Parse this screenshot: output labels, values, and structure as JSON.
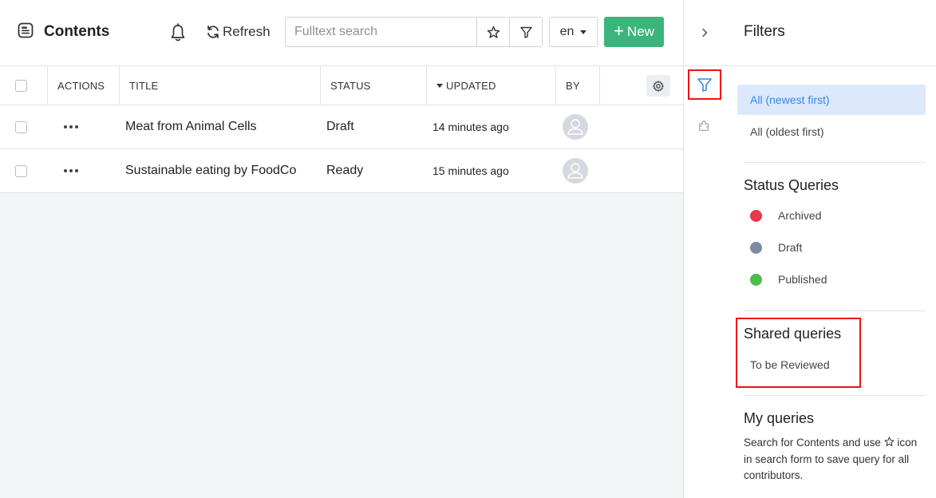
{
  "header": {
    "title": "Contents",
    "refresh_label": "Refresh",
    "search_placeholder": "Fulltext search",
    "language": "en",
    "new_label": "New"
  },
  "table": {
    "columns": [
      "ACTIONS",
      "TITLE",
      "STATUS",
      "UPDATED",
      "BY"
    ],
    "rows": [
      {
        "title": "Meat from Animal Cells",
        "status": "Draft",
        "updated": "14 minutes ago"
      },
      {
        "title": "Sustainable eating by FoodCo",
        "status": "Ready",
        "updated": "15 minutes ago"
      }
    ]
  },
  "filters": {
    "title": "Filters",
    "default_queries": [
      "All (newest first)",
      "All (oldest first)"
    ],
    "status_title": "Status Queries",
    "status_queries": [
      {
        "label": "Archived",
        "color": "#e8384f"
      },
      {
        "label": "Draft",
        "color": "#7b8ba1"
      },
      {
        "label": "Published",
        "color": "#4bbd4b"
      }
    ],
    "shared_title": "Shared queries",
    "shared_queries": [
      "To be Reviewed"
    ],
    "my_title": "My queries",
    "my_description_prefix": "Search for Contents and use",
    "my_description_suffix": "icon in search form to save query for all contributors."
  },
  "colors": {
    "accent": "#3389ea",
    "new_button": "#3cb57c",
    "highlight": "#e11111"
  }
}
